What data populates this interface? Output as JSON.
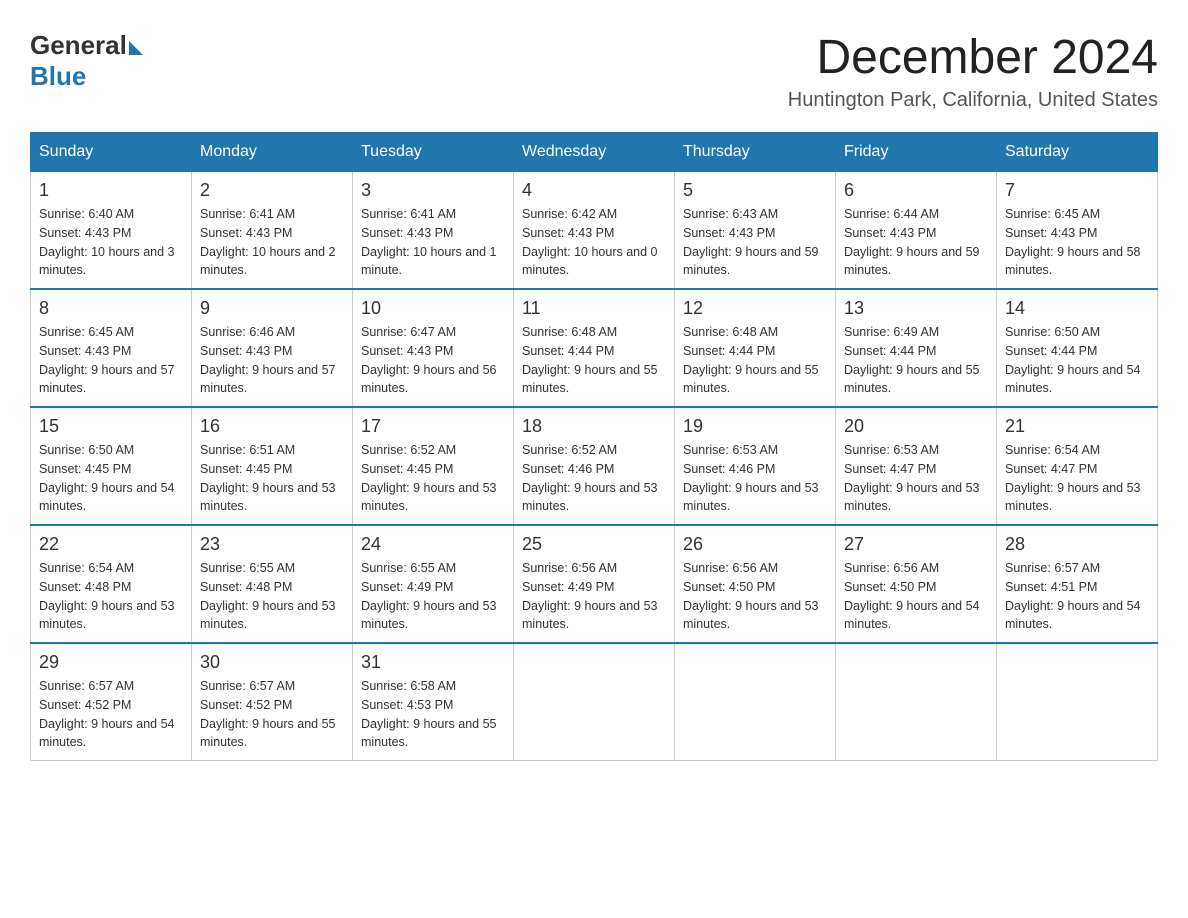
{
  "header": {
    "logo_general": "General",
    "logo_blue": "Blue",
    "month_title": "December 2024",
    "location": "Huntington Park, California, United States"
  },
  "weekdays": [
    "Sunday",
    "Monday",
    "Tuesday",
    "Wednesday",
    "Thursday",
    "Friday",
    "Saturday"
  ],
  "weeks": [
    [
      {
        "day": "1",
        "sunrise": "6:40 AM",
        "sunset": "4:43 PM",
        "daylight": "10 hours and 3 minutes."
      },
      {
        "day": "2",
        "sunrise": "6:41 AM",
        "sunset": "4:43 PM",
        "daylight": "10 hours and 2 minutes."
      },
      {
        "day": "3",
        "sunrise": "6:41 AM",
        "sunset": "4:43 PM",
        "daylight": "10 hours and 1 minute."
      },
      {
        "day": "4",
        "sunrise": "6:42 AM",
        "sunset": "4:43 PM",
        "daylight": "10 hours and 0 minutes."
      },
      {
        "day": "5",
        "sunrise": "6:43 AM",
        "sunset": "4:43 PM",
        "daylight": "9 hours and 59 minutes."
      },
      {
        "day": "6",
        "sunrise": "6:44 AM",
        "sunset": "4:43 PM",
        "daylight": "9 hours and 59 minutes."
      },
      {
        "day": "7",
        "sunrise": "6:45 AM",
        "sunset": "4:43 PM",
        "daylight": "9 hours and 58 minutes."
      }
    ],
    [
      {
        "day": "8",
        "sunrise": "6:45 AM",
        "sunset": "4:43 PM",
        "daylight": "9 hours and 57 minutes."
      },
      {
        "day": "9",
        "sunrise": "6:46 AM",
        "sunset": "4:43 PM",
        "daylight": "9 hours and 57 minutes."
      },
      {
        "day": "10",
        "sunrise": "6:47 AM",
        "sunset": "4:43 PM",
        "daylight": "9 hours and 56 minutes."
      },
      {
        "day": "11",
        "sunrise": "6:48 AM",
        "sunset": "4:44 PM",
        "daylight": "9 hours and 55 minutes."
      },
      {
        "day": "12",
        "sunrise": "6:48 AM",
        "sunset": "4:44 PM",
        "daylight": "9 hours and 55 minutes."
      },
      {
        "day": "13",
        "sunrise": "6:49 AM",
        "sunset": "4:44 PM",
        "daylight": "9 hours and 55 minutes."
      },
      {
        "day": "14",
        "sunrise": "6:50 AM",
        "sunset": "4:44 PM",
        "daylight": "9 hours and 54 minutes."
      }
    ],
    [
      {
        "day": "15",
        "sunrise": "6:50 AM",
        "sunset": "4:45 PM",
        "daylight": "9 hours and 54 minutes."
      },
      {
        "day": "16",
        "sunrise": "6:51 AM",
        "sunset": "4:45 PM",
        "daylight": "9 hours and 53 minutes."
      },
      {
        "day": "17",
        "sunrise": "6:52 AM",
        "sunset": "4:45 PM",
        "daylight": "9 hours and 53 minutes."
      },
      {
        "day": "18",
        "sunrise": "6:52 AM",
        "sunset": "4:46 PM",
        "daylight": "9 hours and 53 minutes."
      },
      {
        "day": "19",
        "sunrise": "6:53 AM",
        "sunset": "4:46 PM",
        "daylight": "9 hours and 53 minutes."
      },
      {
        "day": "20",
        "sunrise": "6:53 AM",
        "sunset": "4:47 PM",
        "daylight": "9 hours and 53 minutes."
      },
      {
        "day": "21",
        "sunrise": "6:54 AM",
        "sunset": "4:47 PM",
        "daylight": "9 hours and 53 minutes."
      }
    ],
    [
      {
        "day": "22",
        "sunrise": "6:54 AM",
        "sunset": "4:48 PM",
        "daylight": "9 hours and 53 minutes."
      },
      {
        "day": "23",
        "sunrise": "6:55 AM",
        "sunset": "4:48 PM",
        "daylight": "9 hours and 53 minutes."
      },
      {
        "day": "24",
        "sunrise": "6:55 AM",
        "sunset": "4:49 PM",
        "daylight": "9 hours and 53 minutes."
      },
      {
        "day": "25",
        "sunrise": "6:56 AM",
        "sunset": "4:49 PM",
        "daylight": "9 hours and 53 minutes."
      },
      {
        "day": "26",
        "sunrise": "6:56 AM",
        "sunset": "4:50 PM",
        "daylight": "9 hours and 53 minutes."
      },
      {
        "day": "27",
        "sunrise": "6:56 AM",
        "sunset": "4:50 PM",
        "daylight": "9 hours and 54 minutes."
      },
      {
        "day": "28",
        "sunrise": "6:57 AM",
        "sunset": "4:51 PM",
        "daylight": "9 hours and 54 minutes."
      }
    ],
    [
      {
        "day": "29",
        "sunrise": "6:57 AM",
        "sunset": "4:52 PM",
        "daylight": "9 hours and 54 minutes."
      },
      {
        "day": "30",
        "sunrise": "6:57 AM",
        "sunset": "4:52 PM",
        "daylight": "9 hours and 55 minutes."
      },
      {
        "day": "31",
        "sunrise": "6:58 AM",
        "sunset": "4:53 PM",
        "daylight": "9 hours and 55 minutes."
      },
      null,
      null,
      null,
      null
    ]
  ]
}
